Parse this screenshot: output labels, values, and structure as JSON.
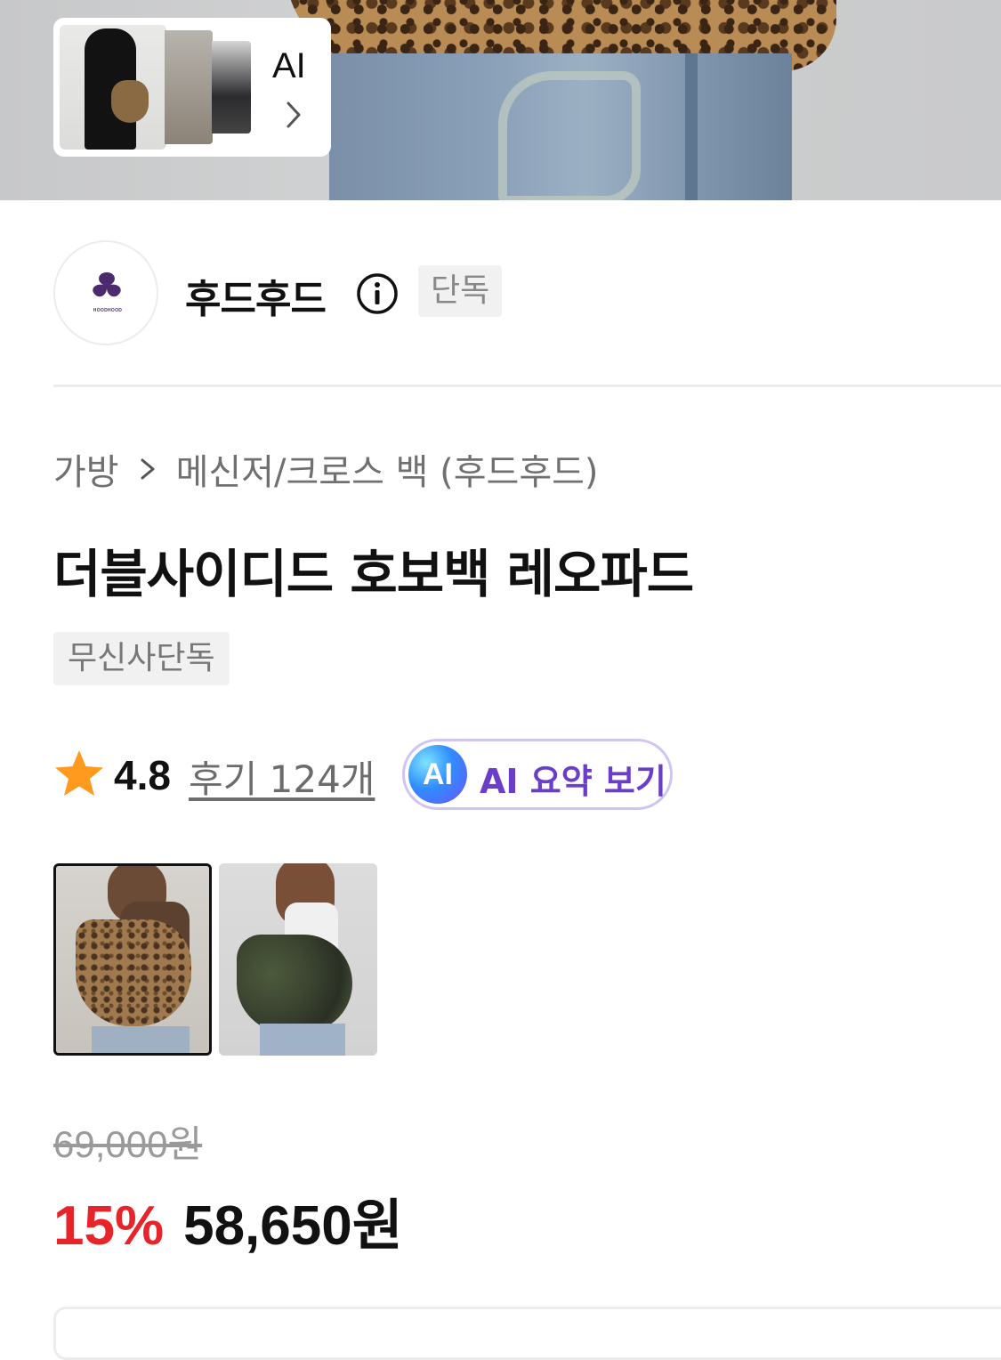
{
  "hero_card": {
    "label": "AI"
  },
  "brand": {
    "name": "후드후드",
    "badge": "단독",
    "logo_text": "HOODHOOD"
  },
  "breadcrumb": {
    "items": [
      "가방",
      "메신저/크로스 백 (후드후드)"
    ]
  },
  "product": {
    "title": "더블사이디드 호보백 레오파드",
    "tag": "무신사단독"
  },
  "rating": {
    "score": "4.8",
    "reviews": "후기 124개",
    "ai_badge": "AI",
    "ai_summary": "AI 요약 보기"
  },
  "options": {
    "selected_index": 0
  },
  "price": {
    "original": "69,000원",
    "discount": "15%",
    "sale": "58,650원"
  },
  "colors": {
    "discount": "#e8242b",
    "ai_accent": "#6b3ec9",
    "ai_border": "#cfc4f4"
  },
  "icons": [
    "chevron-right-icon",
    "info-icon",
    "star-icon",
    "brand-logo"
  ]
}
